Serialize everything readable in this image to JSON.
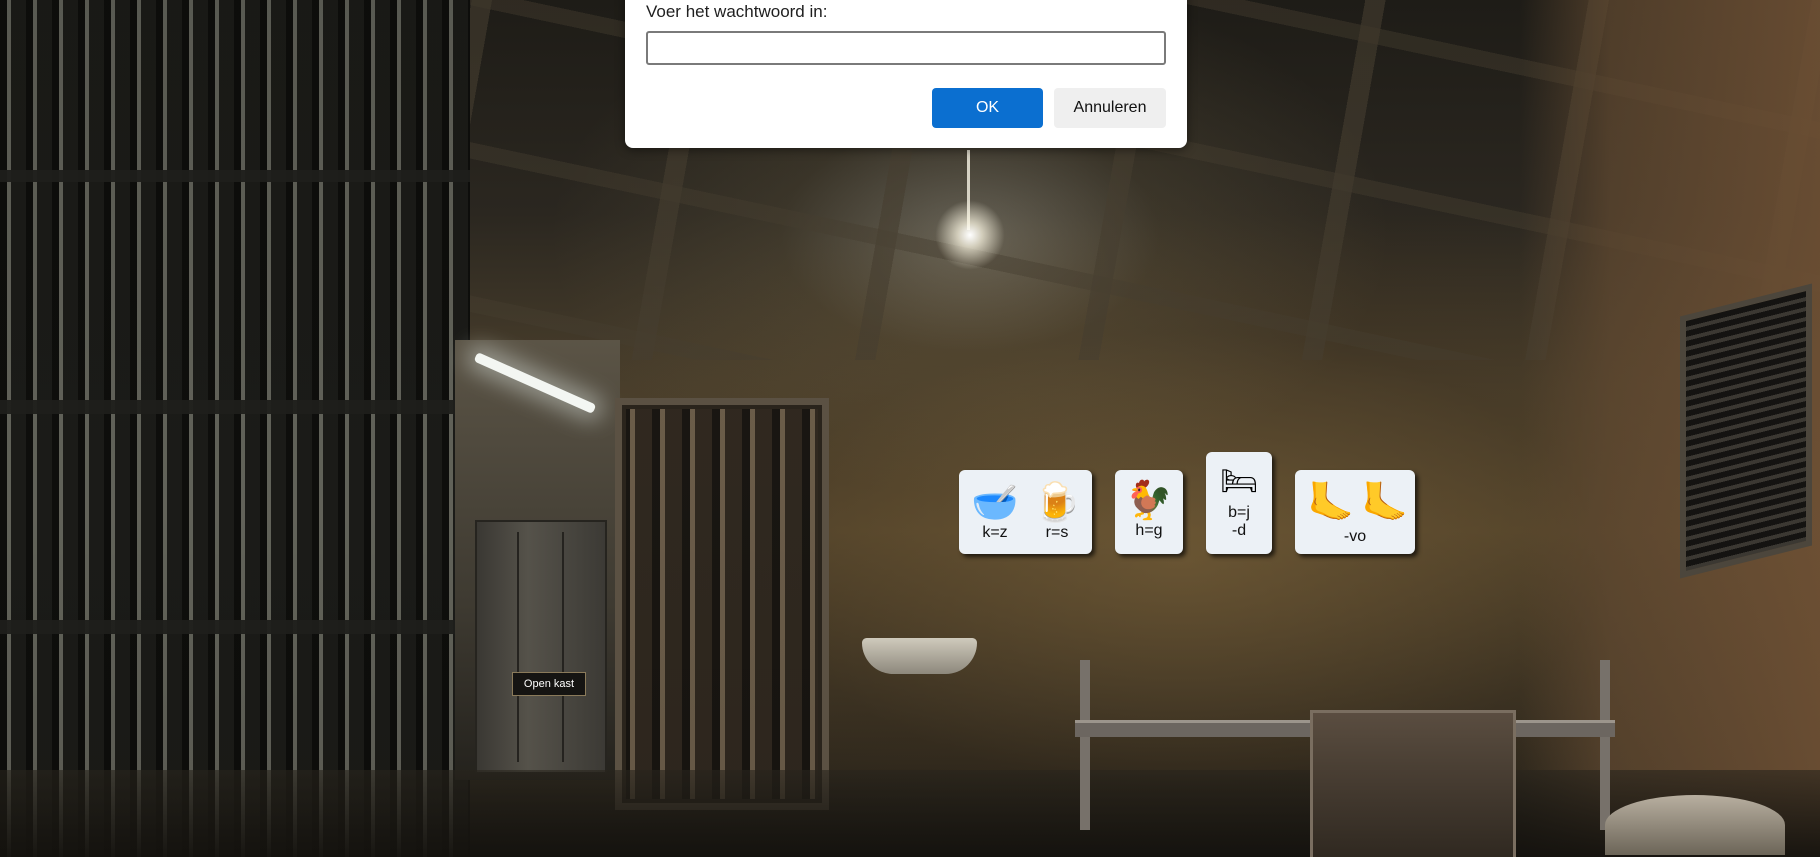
{
  "dialog": {
    "prompt": "Voer het wachtwoord in:",
    "input_value": "",
    "ok_label": "OK",
    "cancel_label": "Annuleren"
  },
  "scene": {
    "open_cabinet_label": "Open kast"
  },
  "clues": {
    "card1": [
      {
        "emoji": "🥣",
        "icon": "bowl-with-spoon-icon",
        "label": "k=z"
      },
      {
        "emoji": "🍺",
        "icon": "beer-mug-icon",
        "label": "r=s"
      }
    ],
    "card2": [
      {
        "emoji": "🐓",
        "icon": "rooster-icon",
        "label": "h=g"
      }
    ],
    "card3": [
      {
        "emoji": "🛏",
        "icon": "bed-icon",
        "label": "b=j\n-d"
      }
    ],
    "card4": [
      {
        "emoji": "🦶",
        "icon": "foot-icon",
        "label": ""
      },
      {
        "emoji": "🦶",
        "icon": "foot-icon",
        "label": ""
      },
      {
        "label": "-vo"
      }
    ]
  },
  "colors": {
    "ok_button": "#0b6fd0",
    "cancel_button": "#efefef",
    "card_background": "#ecf1f6"
  }
}
